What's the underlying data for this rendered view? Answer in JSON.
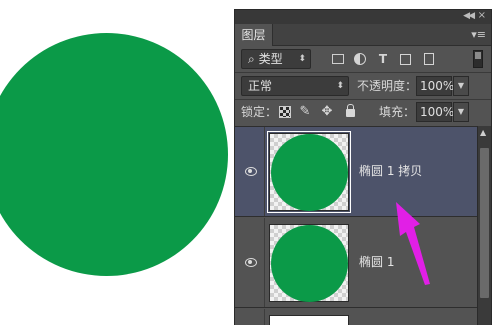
{
  "colors": {
    "shape_green": "#0b9a48",
    "annotation": "#e11fe6",
    "selected_layer": "#4d536a"
  },
  "panel": {
    "tab": "图层",
    "menu_icon": "panel-menu-icon",
    "filter": {
      "label": "类型",
      "icon": "search-icon"
    },
    "blend_mode": "正常",
    "opacity_label": "不透明度：",
    "opacity_value": "100%",
    "lock_label": "锁定：",
    "fill_label": "填充：",
    "fill_value": "100%"
  },
  "layers": [
    {
      "name": "椭圆 1 拷贝",
      "visible": true,
      "selected": true
    },
    {
      "name": "椭圆 1",
      "visible": true,
      "selected": false
    }
  ]
}
